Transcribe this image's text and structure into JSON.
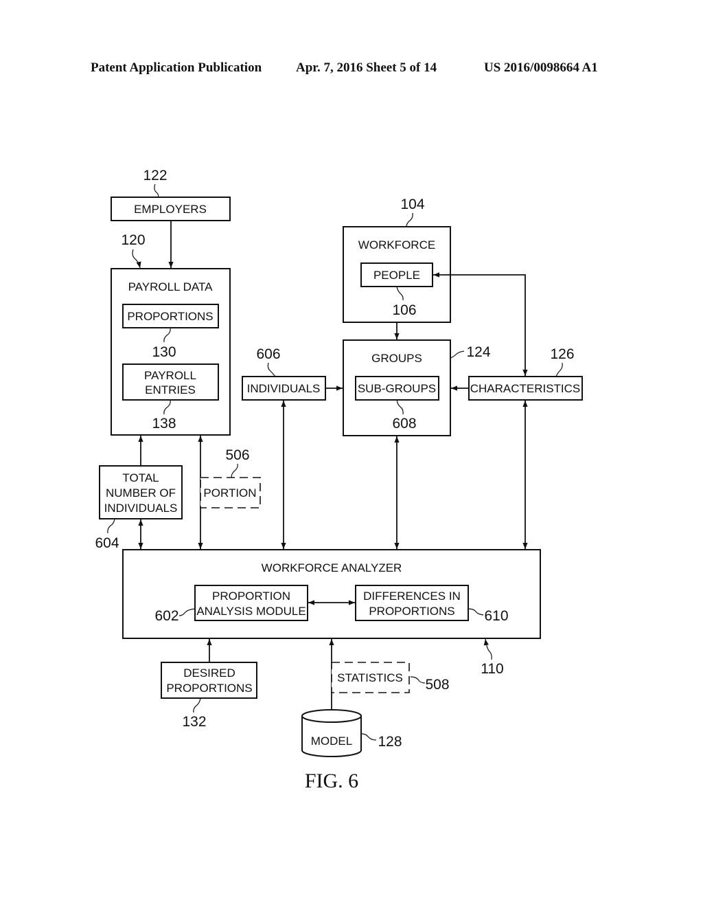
{
  "header": {
    "publication": "Patent Application Publication",
    "date_sheet": "Apr. 7, 2016   Sheet 5 of 14",
    "number": "US 2016/0098664 A1"
  },
  "figure": {
    "caption": "FIG. 6"
  },
  "blocks": {
    "employers": {
      "label": "EMPLOYERS",
      "ref": "122"
    },
    "payroll_data": {
      "label": "PAYROLL DATA",
      "ref": "120"
    },
    "proportions": {
      "label": "PROPORTIONS",
      "ref": "130"
    },
    "payroll_entries": {
      "line1": "PAYROLL",
      "line2": "ENTRIES",
      "ref": "138"
    },
    "workforce": {
      "label": "WORKFORCE",
      "ref": "104"
    },
    "people": {
      "label": "PEOPLE",
      "ref": "106"
    },
    "groups": {
      "label": "GROUPS",
      "ref": "124"
    },
    "sub_groups": {
      "label": "SUB-GROUPS",
      "ref": "608"
    },
    "individuals": {
      "label": "INDIVIDUALS",
      "ref": "606"
    },
    "characteristics": {
      "label": "CHARACTERISTICS",
      "ref": "126"
    },
    "total_individuals": {
      "line1": "TOTAL",
      "line2": "NUMBER OF",
      "line3": "INDIVIDUALS",
      "ref": "604"
    },
    "portion": {
      "label": "PORTION",
      "ref": "506"
    },
    "workforce_analyzer": {
      "label": "WORKFORCE ANALYZER",
      "ref": "110"
    },
    "proportion_analysis": {
      "line1": "PROPORTION",
      "line2": "ANALYSIS MODULE",
      "ref": "602"
    },
    "differences": {
      "line1": "DIFFERENCES IN",
      "line2": "PROPORTIONS",
      "ref": "610"
    },
    "desired_proportions": {
      "line1": "DESIRED",
      "line2": "PROPORTIONS",
      "ref": "132"
    },
    "statistics": {
      "label": "STATISTICS",
      "ref": "508"
    },
    "model": {
      "label": "MODEL",
      "ref": "128"
    }
  }
}
